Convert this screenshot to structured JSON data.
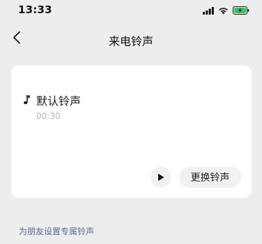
{
  "status_bar": {
    "time": "13:33",
    "icons": [
      "signal-icon",
      "wifi-icon",
      "battery-charging-icon"
    ],
    "battery_color": "#33c759"
  },
  "nav": {
    "title": "来电铃声",
    "back_icon": "chevron-left-icon"
  },
  "ringtone": {
    "icon": "music-note-icon",
    "name": "默认铃声",
    "duration": "00:30",
    "play_icon": "play-icon",
    "change_label": "更换铃声"
  },
  "footer": {
    "friend_link": "为朋友设置专属铃声",
    "link_color": "#576b95"
  }
}
